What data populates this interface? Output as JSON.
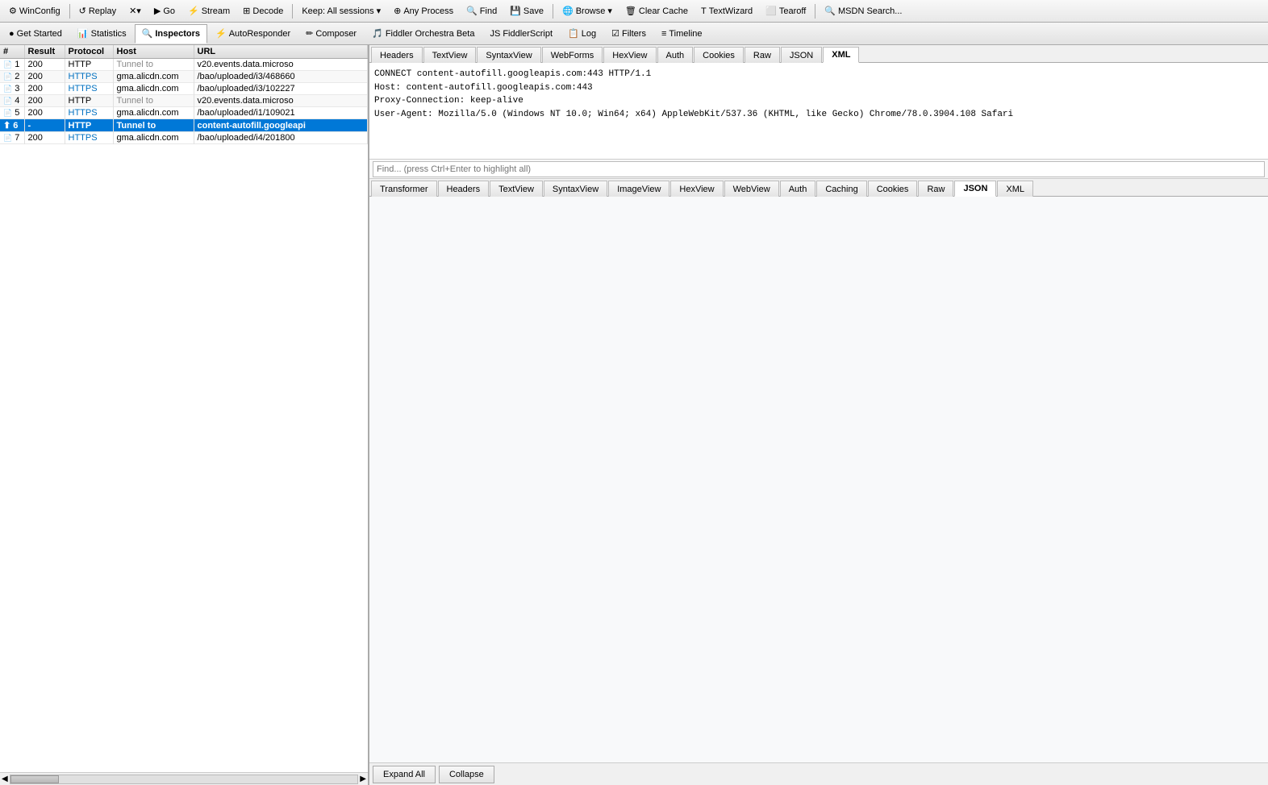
{
  "toolbar": {
    "items": [
      {
        "id": "winconfig",
        "label": "WinConfig",
        "icon": "⚙"
      },
      {
        "id": "replay",
        "label": "Replay",
        "icon": "↺"
      },
      {
        "id": "x",
        "label": "✕",
        "icon": ""
      },
      {
        "id": "go",
        "label": "Go",
        "icon": "▶"
      },
      {
        "id": "stream",
        "label": "Stream",
        "icon": "⚡"
      },
      {
        "id": "decode",
        "label": "Decode",
        "icon": "⊞"
      },
      {
        "id": "keep",
        "label": "Keep: All sessions",
        "icon": ""
      },
      {
        "id": "any-process",
        "label": "Any Process",
        "icon": "⊕"
      },
      {
        "id": "find",
        "label": "Find",
        "icon": "🔍"
      },
      {
        "id": "save",
        "label": "Save",
        "icon": "💾"
      },
      {
        "id": "browse",
        "label": "Browse",
        "icon": "🌐"
      },
      {
        "id": "clear-cache",
        "label": "Clear Cache",
        "icon": "🗑"
      },
      {
        "id": "textwizard",
        "label": "TextWizard",
        "icon": "T"
      },
      {
        "id": "tearoff",
        "label": "Tearoff",
        "icon": "⬜"
      },
      {
        "id": "msdn-search",
        "label": "MSDN Search...",
        "icon": ""
      }
    ]
  },
  "tabbar2": {
    "items": [
      {
        "id": "get-started",
        "label": "Get Started",
        "icon": "●",
        "active": false
      },
      {
        "id": "statistics",
        "label": "Statistics",
        "icon": "📊",
        "active": false
      },
      {
        "id": "inspectors",
        "label": "Inspectors",
        "icon": "🔍",
        "active": true
      },
      {
        "id": "autoresponder",
        "label": "AutoResponder",
        "icon": "⚡",
        "active": false
      },
      {
        "id": "composer",
        "label": "Composer",
        "icon": "✏",
        "active": false
      },
      {
        "id": "fiddler-orchestra-beta",
        "label": "Fiddler Orchestra Beta",
        "icon": "🎵",
        "active": false
      },
      {
        "id": "fiddlerscript",
        "label": "FiddlerScript",
        "icon": "JS",
        "active": false
      },
      {
        "id": "log",
        "label": "Log",
        "icon": "📋",
        "active": false
      },
      {
        "id": "filters",
        "label": "Filters",
        "icon": "☑",
        "active": false
      },
      {
        "id": "timeline",
        "label": "Timeline",
        "icon": "≡",
        "active": false
      }
    ]
  },
  "sessions_table": {
    "columns": [
      "#",
      "Result",
      "Protocol",
      "Host",
      "URL"
    ],
    "rows": [
      {
        "id": 1,
        "icon": "📄",
        "result": "200",
        "protocol": "HTTP",
        "host": "Tunnel to",
        "url": "v20.events.data.microso",
        "selected": false,
        "icon_type": "page"
      },
      {
        "id": 2,
        "icon": "📄",
        "result": "200",
        "protocol": "HTTPS",
        "host": "gma.alicdn.com",
        "url": "/bao/uploaded/i3/468660",
        "selected": false,
        "icon_type": "page"
      },
      {
        "id": 3,
        "icon": "📄",
        "result": "200",
        "protocol": "HTTPS",
        "host": "gma.alicdn.com",
        "url": "/bao/uploaded/i3/102227",
        "selected": false,
        "icon_type": "page"
      },
      {
        "id": 4,
        "icon": "📄",
        "result": "200",
        "protocol": "HTTP",
        "host": "Tunnel to",
        "url": "v20.events.data.microso",
        "selected": false,
        "icon_type": "page"
      },
      {
        "id": 5,
        "icon": "📄",
        "result": "200",
        "protocol": "HTTPS",
        "host": "gma.alicdn.com",
        "url": "/bao/uploaded/i1/109021",
        "selected": false,
        "icon_type": "page"
      },
      {
        "id": 6,
        "icon": "⬆",
        "result": "-",
        "protocol": "HTTP",
        "host": "Tunnel to",
        "url": "content-autofill.googleapi",
        "selected": true,
        "icon_type": "upload",
        "bold": true
      },
      {
        "id": 7,
        "icon": "📄",
        "result": "200",
        "protocol": "HTTPS",
        "host": "gma.alicdn.com",
        "url": "/bao/uploaded/i4/201800",
        "selected": false,
        "icon_type": "page"
      }
    ]
  },
  "upper_inspector_tabs": {
    "tabs": [
      {
        "id": "headers",
        "label": "Headers",
        "active": false
      },
      {
        "id": "textview",
        "label": "TextView",
        "active": false
      },
      {
        "id": "syntaxview",
        "label": "SyntaxView",
        "active": false
      },
      {
        "id": "webforms",
        "label": "WebForms",
        "active": false
      },
      {
        "id": "hexview",
        "label": "HexView",
        "active": false
      },
      {
        "id": "auth",
        "label": "Auth",
        "active": false
      },
      {
        "id": "cookies",
        "label": "Cookies",
        "active": false
      },
      {
        "id": "raw",
        "label": "Raw",
        "active": false
      },
      {
        "id": "json",
        "label": "JSON",
        "active": false
      },
      {
        "id": "xml",
        "label": "XML",
        "active": true
      }
    ]
  },
  "request_content": {
    "lines": [
      "CONNECT content-autofill.googleapis.com:443 HTTP/1.1",
      "Host: content-autofill.googleapis.com:443",
      "Proxy-Connection: keep-alive",
      "User-Agent: Mozilla/5.0 (Windows NT 10.0; Win64; x64) AppleWebKit/537.36 (KHTML, like Gecko) Chrome/78.0.3904.108 Safari"
    ]
  },
  "find_bar": {
    "placeholder": "Find... (press Ctrl+Enter to highlight all)"
  },
  "lower_inspector_tabs": {
    "tabs": [
      {
        "id": "transformer",
        "label": "Transformer",
        "active": false
      },
      {
        "id": "headers",
        "label": "Headers",
        "active": false
      },
      {
        "id": "textview",
        "label": "TextView",
        "active": false
      },
      {
        "id": "syntaxview",
        "label": "SyntaxView",
        "active": false
      },
      {
        "id": "imageview",
        "label": "ImageView",
        "active": false
      },
      {
        "id": "hexview",
        "label": "HexView",
        "active": false
      },
      {
        "id": "webview",
        "label": "WebView",
        "active": false
      },
      {
        "id": "auth",
        "label": "Auth",
        "active": false
      },
      {
        "id": "caching",
        "label": "Caching",
        "active": false
      },
      {
        "id": "cookies",
        "label": "Cookies",
        "active": false
      },
      {
        "id": "raw",
        "label": "Raw",
        "active": false
      },
      {
        "id": "json",
        "label": "JSON",
        "active": true
      },
      {
        "id": "xml",
        "label": "XML",
        "active": false
      }
    ]
  },
  "bottom_buttons": {
    "expand_all": "Expand All",
    "collapse": "Collapse"
  },
  "colors": {
    "selected_row_bg": "#0078d7",
    "selected_row_text": "#ffffff",
    "active_tab_bg": "#ffffff",
    "header_bg": "#f0f0f0"
  }
}
